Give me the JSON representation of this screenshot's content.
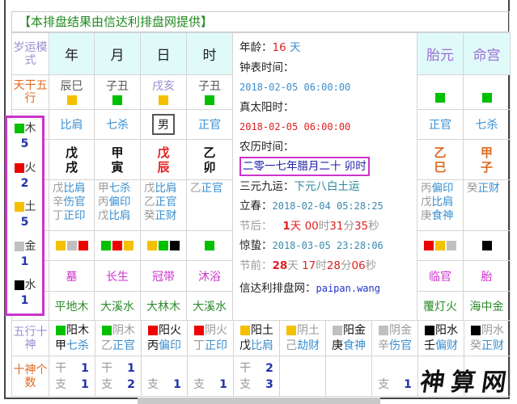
{
  "title": "【本排盘结果由信达利排盘网提供】",
  "header": {
    "label": "岁运模式",
    "cols": [
      "年",
      "月",
      "日",
      "时"
    ],
    "extra": [
      "胎元",
      "命宫"
    ]
  },
  "labels": {
    "tiangan_wuxing": "天干五行",
    "wuxing_shishen": "五行十神",
    "shishen_count": "十神个数"
  },
  "pillars": [
    {
      "kongwang": "辰巳",
      "kw_color": "#f5c000",
      "shishen": "比肩",
      "stem": "戊",
      "branch": "戌",
      "hidden": [
        [
          "戊",
          "比肩"
        ],
        [
          "辛",
          "伤官"
        ],
        [
          "丁",
          "正印"
        ]
      ],
      "colors": [
        "#f5c000",
        "#c0c0c0",
        "#ee0000"
      ],
      "changsheng": "墓",
      "nayin": "平地木"
    },
    {
      "kongwang": "子丑",
      "kw_color": "#00c000",
      "shishen": "七杀",
      "stem": "甲",
      "branch": "寅",
      "hidden": [
        [
          "甲",
          "七杀"
        ],
        [
          "丙",
          "偏印"
        ],
        [
          "戊",
          "比肩"
        ]
      ],
      "colors": [
        "#00c000",
        "#ee0000",
        "#f5c000"
      ],
      "changsheng": "长生",
      "nayin": "大溪水"
    },
    {
      "kongwang": "戌亥",
      "kw_color": "#f5c000",
      "shishen": "男",
      "stem": "戊",
      "branch": "辰",
      "hidden": [
        [
          "戊",
          "比肩"
        ],
        [
          "乙",
          "正官"
        ],
        [
          "癸",
          "正财"
        ]
      ],
      "colors": [
        "#f5c000",
        "#00c000",
        "#000000"
      ],
      "changsheng": "冠带",
      "nayin": "大林木"
    },
    {
      "kongwang": "子丑",
      "kw_color": "#00c000",
      "shishen": "正官",
      "stem": "乙",
      "branch": "卯",
      "hidden": [
        [
          "乙",
          "正官"
        ]
      ],
      "colors": [
        "#00c000"
      ],
      "changsheng": "沐浴",
      "nayin": "大溪水"
    }
  ],
  "extra_pillars": [
    {
      "kw_color": "#00c000",
      "shishen": "正官",
      "stem": "乙",
      "branch": "巳",
      "hidden": [
        [
          "丙",
          "偏印"
        ],
        [
          "戊",
          "比肩"
        ],
        [
          "庚",
          "食神"
        ]
      ],
      "colors": [
        "#ee0000",
        "#f5c000",
        "#c0c0c0"
      ],
      "changsheng": "临官",
      "nayin": "覆灯火"
    },
    {
      "kw_color": "#00c000",
      "shishen": "七杀",
      "stem": "甲",
      "branch": "子",
      "hidden": [
        [
          "癸",
          "正财"
        ]
      ],
      "colors": [
        "#000000"
      ],
      "changsheng": "胎",
      "nayin": "海中金"
    }
  ],
  "elements": [
    {
      "name": "木",
      "count": "5",
      "color": "#00c000"
    },
    {
      "name": "火",
      "count": "2",
      "color": "#ee0000"
    },
    {
      "name": "土",
      "count": "5",
      "color": "#f5c000"
    },
    {
      "name": "金",
      "count": "1",
      "color": "#c0c0c0"
    },
    {
      "name": "水",
      "count": "1",
      "color": "#000000"
    }
  ],
  "info": {
    "age_label": "年龄：",
    "age_value": "16",
    "age_unit": "天",
    "clock_label": "钟表时间：",
    "clock_value": "2018-02-05 06:00:00",
    "solar_label": "真太阳时：",
    "solar_value": "2018-02-05 06:00:00",
    "lunar_label": "农历时间：",
    "lunar_value": "二零一七年腊月二十 卯时",
    "yun_label": "三元九运：",
    "yun_value": "下元八白土运",
    "lichun_label": "立春：",
    "lichun_value": "2018-02-04 05:28:25",
    "after_label": "节后：",
    "after_d": "1",
    "after_du": "天",
    "after_h": "00",
    "after_hu": "时",
    "after_m": "31",
    "after_mu": "分",
    "after_s": "35",
    "after_su": "秒",
    "jingzhe_label": "惊蛰：",
    "jingzhe_value": "2018-03-05 23:28:06",
    "before_label": "节前：",
    "before_d": "28",
    "before_du": "天",
    "before_h": "17",
    "before_hu": "时",
    "before_m": "28",
    "before_mu": "分",
    "before_s": "06",
    "before_su": "秒",
    "site_label": "信达利排盘网：",
    "site_value": "paipan.wang"
  },
  "gods": [
    {
      "color": "#00c000",
      "wx": "阳木",
      "stem": "甲",
      "god": "七杀",
      "dark": true,
      "gan": "1",
      "zhi": "1"
    },
    {
      "color": "#00c000",
      "wx": "阴木",
      "stem": "乙",
      "god": "正官",
      "dark": false,
      "gan": "1",
      "zhi": "2"
    },
    {
      "color": "#ee0000",
      "wx": "阳火",
      "stem": "丙",
      "god": "偏印",
      "dark": true,
      "gan": null,
      "zhi": "1"
    },
    {
      "color": "#ee0000",
      "wx": "阴火",
      "stem": "丁",
      "god": "正印",
      "dark": false,
      "gan": null,
      "zhi": "1"
    },
    {
      "color": "#f5c000",
      "wx": "阳土",
      "stem": "戊",
      "god": "比肩",
      "dark": true,
      "gan": "2",
      "zhi": "3"
    },
    {
      "color": "#f5c000",
      "wx": "阴土",
      "stem": "己",
      "god": "劫财",
      "dark": false,
      "gan": null,
      "zhi": null
    },
    {
      "color": "#c0c0c0",
      "wx": "阳金",
      "stem": "庚",
      "god": "食神",
      "dark": true,
      "gan": null,
      "zhi": null
    },
    {
      "color": "#c0c0c0",
      "wx": "阴金",
      "stem": "辛",
      "god": "伤官",
      "dark": false,
      "gan": null,
      "zhi": "1"
    },
    {
      "color": "#000000",
      "wx": "阳水",
      "stem": "壬",
      "god": "偏财",
      "dark": true,
      "gan": null,
      "zhi": null
    },
    {
      "color": "#000000",
      "wx": "阴水",
      "stem": "癸",
      "god": "正财",
      "dark": false,
      "gan": null,
      "zhi": null
    }
  ],
  "count_labels": {
    "gan": "干",
    "zhi": "支"
  },
  "watermark": "神算网"
}
